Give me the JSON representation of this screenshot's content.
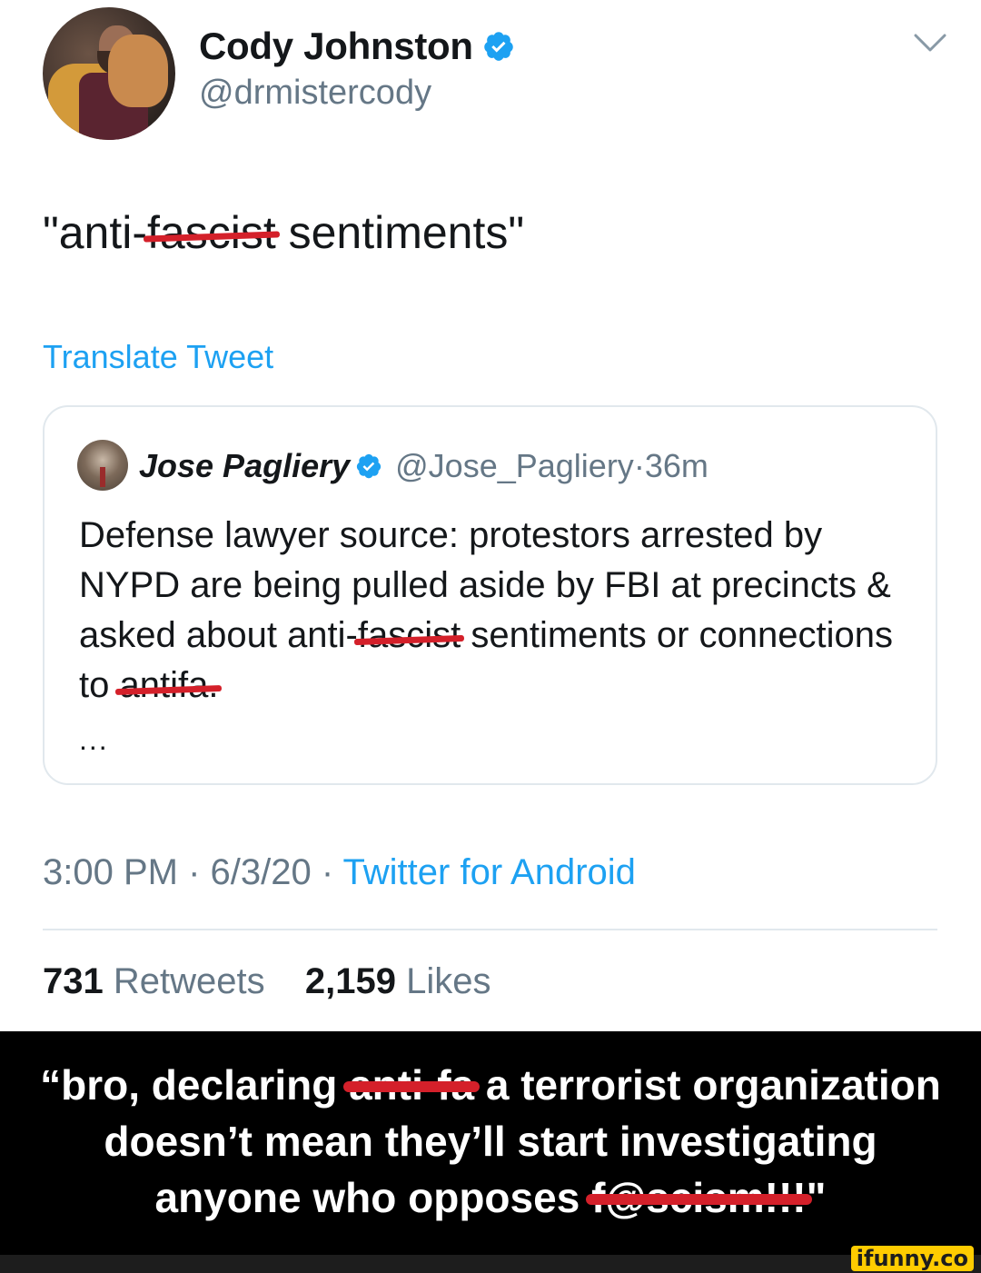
{
  "tweet": {
    "author": {
      "display_name": "Cody Johnston",
      "handle": "@drmistercody",
      "verified_icon": "verified-badge-icon"
    },
    "text": {
      "open_quote": "\"anti-",
      "struck_word": "fascist",
      "rest": " sentiments\""
    },
    "translate_label": "Translate Tweet",
    "quoted": {
      "display_name": "Jose Pagliery",
      "handle": "@Jose_Pagliery",
      "separator": " · ",
      "time": "36m",
      "body_part1": "Defense lawyer source: protestors arrested by NYPD are being pulled aside by FBI at precincts & asked about anti-",
      "body_struck1": "fascist",
      "body_part2": " sentiments or connections to ",
      "body_struck2": "antifa.",
      "ellipsis": "..."
    },
    "meta": {
      "time": "3:00 PM · 6/3/20 · ",
      "source": "Twitter for Android"
    },
    "stats": {
      "retweets_count": "731",
      "retweets_label": " Retweets",
      "likes_count": "2,159",
      "likes_label": " Likes"
    },
    "colors": {
      "link_blue": "#1da1f2",
      "secondary_gray": "#657786",
      "redaction_red": "#d4202a"
    }
  },
  "caption": {
    "line1_start": "“bro, declaring ",
    "line1_struck": "anti-fa",
    "line1_end": " a terrorist organization",
    "line2": "doesn’t mean they’ll start investigating",
    "line3_start": "anyone who opposes ",
    "line3_struck": "f@scism!!!",
    "line3_end": "\""
  },
  "watermark": "ifunny.co"
}
